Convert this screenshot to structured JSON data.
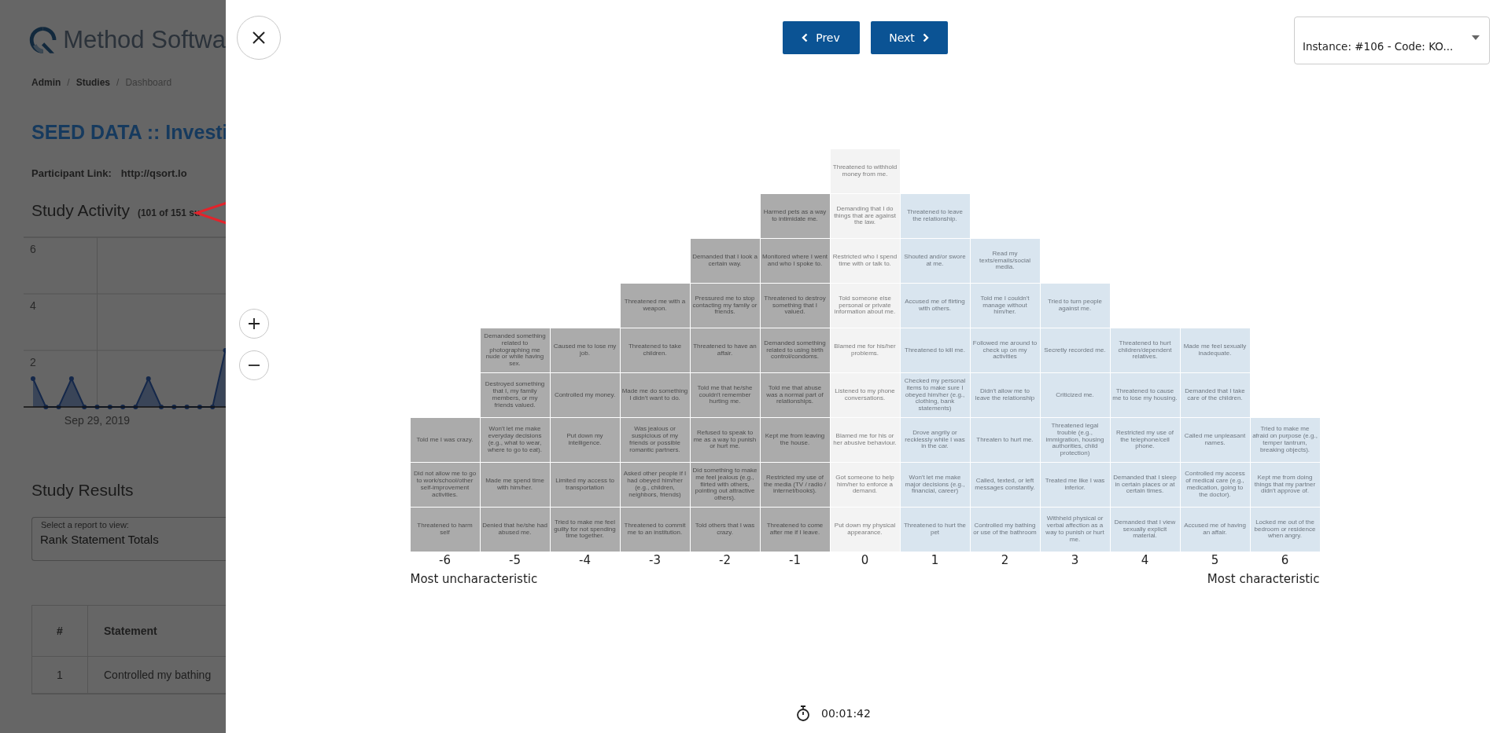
{
  "background_page": {
    "logo_text": "Method Softwa",
    "breadcrumb": {
      "separator": "/",
      "items": [
        {
          "label": "Admin",
          "current": false
        },
        {
          "label": "Studies",
          "current": false
        },
        {
          "label": "Dashboard",
          "current": true
        }
      ]
    },
    "title": "SEED DATA :: Investi",
    "participant_link": {
      "label": "Participant Link:",
      "value": "http://qsort.lo"
    },
    "study_activity": {
      "title": "Study Activity",
      "subtitle": "(101 of 151 su",
      "date_label": "Sep 29, 2019",
      "chart_data": {
        "type": "area",
        "grid": true,
        "yticks": [
          2,
          4,
          6
        ],
        "ylim": [
          0,
          6
        ],
        "values": [
          1,
          0,
          0,
          1,
          0,
          0,
          0,
          0,
          0,
          1,
          0,
          0,
          0,
          0,
          0,
          2
        ]
      }
    },
    "study_results": {
      "title": "Study Results",
      "report_select": {
        "label": "Select a report to view:",
        "value": "Rank Statement Totals"
      },
      "table": {
        "columns": [
          "#",
          "Statement"
        ],
        "rows": [
          [
            "1",
            "Controlled my bathing"
          ]
        ]
      }
    }
  },
  "modal": {
    "nav": {
      "prev": "Prev",
      "next": "Next"
    },
    "instance_select": {
      "value": "Instance: #106 - Code: KO..."
    },
    "sort_board": {
      "columns": [
        {
          "label": "-6",
          "kind": "negative",
          "statements": [
            "Told me I was crazy.",
            "Did not allow me to go to work/school/other self-improvement activities.",
            "Threatened to harm self"
          ]
        },
        {
          "label": "-5",
          "kind": "negative",
          "statements": [
            "Demanded something related to photographing me nude or while having sex.",
            "Destroyed something that I, my family members, or my friends valued.",
            "Won't let me make everyday decisions (e.g., what to wear, where to go to eat).",
            "Made me spend time with him/her.",
            "Denied that he/she had abused me."
          ]
        },
        {
          "label": "-4",
          "kind": "negative",
          "statements": [
            "Caused me to lose my job.",
            "Controlled my money.",
            "Put down my intelligence.",
            "Limited my access to transportation",
            "Tried to make me feel guilty for not spending time together."
          ]
        },
        {
          "label": "-3",
          "kind": "negative",
          "statements": [
            "Threatened me with a weapon.",
            "Threatened to take children.",
            "Made me do something I didn't want to do.",
            "Was jealous or suspicious of my friends or possible romantic partners.",
            "Asked other people if I had obeyed him/her (e.g., children, neighbors, friends)",
            "Threatened to commit me to an institution."
          ]
        },
        {
          "label": "-2",
          "kind": "negative",
          "statements": [
            "Demanded that I look a certain way.",
            "Pressured me to stop contacting my family or friends.",
            "Threatened to have an affair.",
            "Told me that he/she couldn't remember hurting me.",
            "Refused to speak to me as a way to punish or hurt me.",
            "Did something to make me feel jealous (e.g., flirted with others, pointing out attractive others).",
            "Told others that I was crazy."
          ]
        },
        {
          "label": "-1",
          "kind": "negative",
          "statements": [
            "Harmed pets as a way to intimidate me.",
            "Monitored where I went and who I spoke to.",
            "Threatened to destroy something that I valued.",
            "Demanded something related to using birth control/condoms.",
            "Told me that abuse was a normal part of relationships.",
            "Kept me from leaving the house.",
            "Restricted my use of the media (TV / radio / internet/books).",
            "Threatened to come after me if I leave."
          ]
        },
        {
          "label": "0",
          "kind": "neutral",
          "statements": [
            "Threatened to withhold money from me.",
            "Demanding that I do things that are against the law.",
            "Restricted who I spend time with or talk to.",
            "Told someone else personal or private information about me.",
            "Blamed me for his/her problems.",
            "Listened to my phone conversations.",
            "Blamed me for his or her abusive behaviour.",
            "Got someone to help him/her to enforce a demand.",
            "Put down my physical appearance."
          ]
        },
        {
          "label": "1",
          "kind": "positive",
          "statements": [
            "Threatened to leave the relationship.",
            "Shouted and/or swore at me.",
            "Accused me of flirting with others.",
            "Threatened to kill me.",
            "Checked my personal items to make sure I obeyed him/her (e.g., clothing, bank statements)",
            "Drove angrily or recklessly while I was in the car.",
            "Won't let me make major decisions (e.g., financial, career)",
            "Threatened to hurt the pet"
          ]
        },
        {
          "label": "2",
          "kind": "positive",
          "statements": [
            "Read my texts/emails/social media.",
            "Told me I couldn't manage without him/her.",
            "Followed me around to check up on my activities",
            "Didn't allow me to leave the relationship",
            "Threaten to hurt me.",
            "Called, texted, or left messages constantly.",
            "Controlled my bathing or use of the bathroom"
          ]
        },
        {
          "label": "3",
          "kind": "positive",
          "statements": [
            "Tried to turn people against me.",
            "Secretly recorded me.",
            "Criticized me.",
            "Threatened legal trouble (e.g., immigration, housing authorities, child protection)",
            "Treated me like I was inferior.",
            "Withheld physical or verbal affection as a way to punish or hurt me."
          ]
        },
        {
          "label": "4",
          "kind": "positive",
          "statements": [
            "Threatened to hurt children/dependent relatives.",
            "Threatened to cause me to lose my housing.",
            "Restricted my use of the telephone/cell phone.",
            "Demanded that I sleep in certain places or at certain times.",
            "Demanded that I view sexually explicit material."
          ]
        },
        {
          "label": "5",
          "kind": "positive",
          "statements": [
            "Made me feel sexually inadequate.",
            "Demanded that I take care of the children.",
            "Called me unpleasant names.",
            "Controlled my access of medical care (e.g., medication, going to the doctor).",
            "Accused me of having an affair."
          ]
        },
        {
          "label": "6",
          "kind": "positive",
          "statements": [
            "Tried to make me afraid on purpose (e.g., temper tantrum, breaking objects).",
            "Kept me from doing things that my partner didn't approve of.",
            "Locked me out of the bedroom or residence when angry."
          ]
        }
      ],
      "left_end": "Most uncharacteristic",
      "right_end": "Most characteristic"
    },
    "timer": "00:01:42"
  }
}
